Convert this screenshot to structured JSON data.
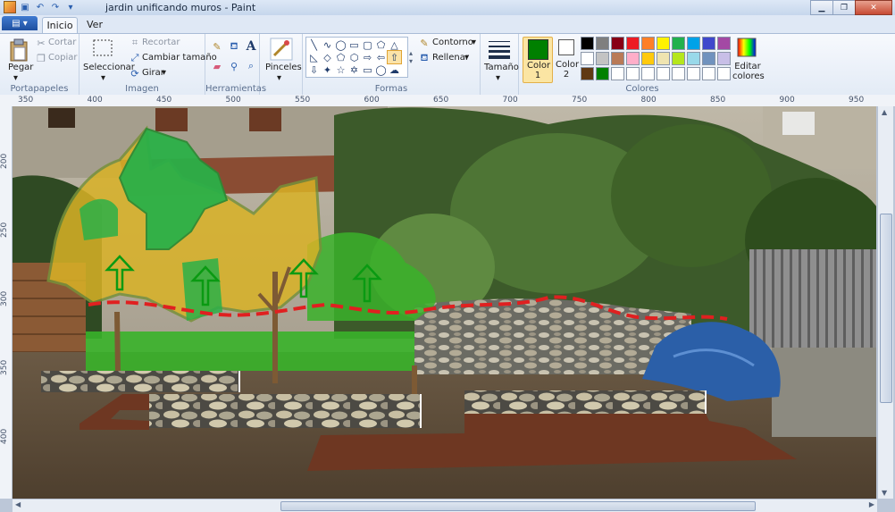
{
  "window": {
    "title": "jardin unificando muros - Paint"
  },
  "tabs": {
    "file": "▤ ▾",
    "home": "Inicio",
    "view": "Ver"
  },
  "clipboard": {
    "paste": "Pegar",
    "cut": "Cortar",
    "copy": "Copiar",
    "label": "Portapapeles"
  },
  "image": {
    "select": "Seleccionar",
    "crop": "Recortar",
    "resize": "Cambiar tamaño",
    "rotate": "Girar",
    "label": "Imagen"
  },
  "tools": {
    "label": "Herramientas"
  },
  "brushes": {
    "label": "Pinceles"
  },
  "shapes": {
    "outline": "Contorno",
    "fill": "Rellenar",
    "label": "Formas"
  },
  "size": {
    "label": "Tamaño"
  },
  "colors": {
    "color1": "Color 1",
    "color2": "Color 2",
    "edit": "Editar colores",
    "label": "Colores",
    "color1_value": "#008000",
    "color2_value": "#ffffff",
    "palette": [
      "#000000",
      "#7f7f7f",
      "#880015",
      "#ed1c24",
      "#ff7f27",
      "#fff200",
      "#22b14c",
      "#00a2e8",
      "#3f48cc",
      "#a349a4",
      "#ffffff",
      "#c3c3c3",
      "#b97a57",
      "#ffaec9",
      "#ffc90e",
      "#efe4b0",
      "#b5e61d",
      "#99d9ea",
      "#7092be",
      "#c8bfe7",
      "#603913",
      "#008000",
      "#ffffff",
      "#ffffff",
      "#ffffff",
      "#ffffff",
      "#ffffff",
      "#ffffff",
      "#ffffff",
      "#ffffff"
    ]
  },
  "ruler": {
    "top": [
      "350",
      "400",
      "450",
      "500",
      "550",
      "600",
      "650",
      "700",
      "750",
      "800",
      "850",
      "900",
      "950"
    ],
    "left": [
      "200",
      "250",
      "300",
      "350",
      "400"
    ]
  }
}
